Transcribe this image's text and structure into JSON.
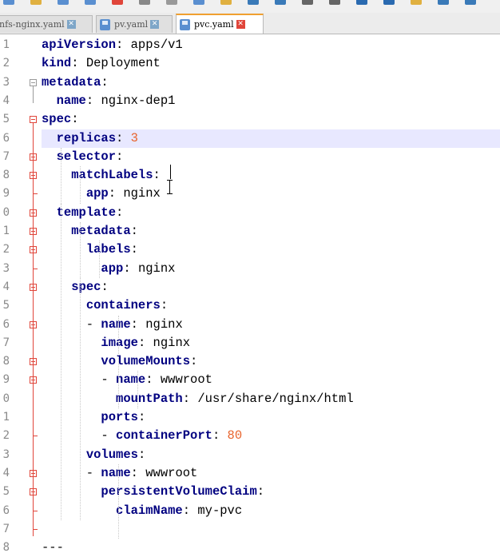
{
  "toolbar": {
    "icons": [
      "new-file-icon",
      "open-file-icon",
      "save-icon",
      "save-all-icon",
      "close-icon",
      "print-icon",
      "cut-icon",
      "copy-icon",
      "paste-icon",
      "undo-icon",
      "redo-icon",
      "find-icon",
      "replace-icon",
      "zoom-in-icon",
      "zoom-out-icon",
      "sync-icon",
      "wrap-icon",
      "indent-guide-icon"
    ]
  },
  "tabs": [
    {
      "label": "nfs-nginx.yaml",
      "active": false
    },
    {
      "label": "pv.yaml",
      "active": false
    },
    {
      "label": "pvc.yaml",
      "active": true
    }
  ],
  "editor": {
    "current_line": 6,
    "lines": [
      {
        "num": "1",
        "indent": "",
        "key": "apiVersion",
        "sep": ": ",
        "value": "apps/v1",
        "vtype": "str"
      },
      {
        "num": "2",
        "indent": "",
        "key": "kind",
        "sep": ": ",
        "value": "Deployment",
        "vtype": "str"
      },
      {
        "num": "3",
        "indent": "",
        "key": "metadata",
        "sep": ":",
        "value": "",
        "vtype": "str"
      },
      {
        "num": "4",
        "indent": "  ",
        "key": "name",
        "sep": ": ",
        "value": "nginx-dep1",
        "vtype": "str"
      },
      {
        "num": "5",
        "indent": "",
        "key": "spec",
        "sep": ":",
        "value": "",
        "vtype": "str"
      },
      {
        "num": "6",
        "indent": "  ",
        "key": "replicas",
        "sep": ": ",
        "value": "3",
        "vtype": "num"
      },
      {
        "num": "7",
        "indent": "  ",
        "key": "selector",
        "sep": ":",
        "value": "",
        "vtype": "str"
      },
      {
        "num": "8",
        "indent": "    ",
        "key": "matchLabels",
        "sep": ":",
        "value": "",
        "vtype": "str"
      },
      {
        "num": "9",
        "indent": "      ",
        "key": "app",
        "sep": ": ",
        "value": "nginx",
        "vtype": "str"
      },
      {
        "num": "0",
        "indent": "  ",
        "key": "template",
        "sep": ":",
        "value": "",
        "vtype": "str"
      },
      {
        "num": "1",
        "indent": "    ",
        "key": "metadata",
        "sep": ":",
        "value": "",
        "vtype": "str"
      },
      {
        "num": "2",
        "indent": "      ",
        "key": "labels",
        "sep": ":",
        "value": "",
        "vtype": "str"
      },
      {
        "num": "3",
        "indent": "        ",
        "key": "app",
        "sep": ": ",
        "value": "nginx",
        "vtype": "str"
      },
      {
        "num": "4",
        "indent": "    ",
        "key": "spec",
        "sep": ":",
        "value": "",
        "vtype": "str"
      },
      {
        "num": "5",
        "indent": "      ",
        "key": "containers",
        "sep": ":",
        "value": "",
        "vtype": "str"
      },
      {
        "num": "6",
        "indent": "      - ",
        "key": "name",
        "sep": ": ",
        "value": "nginx",
        "vtype": "str"
      },
      {
        "num": "7",
        "indent": "        ",
        "key": "image",
        "sep": ": ",
        "value": "nginx",
        "vtype": "str"
      },
      {
        "num": "8",
        "indent": "        ",
        "key": "volumeMounts",
        "sep": ":",
        "value": "",
        "vtype": "str"
      },
      {
        "num": "9",
        "indent": "        - ",
        "key": "name",
        "sep": ": ",
        "value": "wwwroot",
        "vtype": "str"
      },
      {
        "num": "0",
        "indent": "          ",
        "key": "mountPath",
        "sep": ": ",
        "value": "/usr/share/nginx/html",
        "vtype": "str"
      },
      {
        "num": "1",
        "indent": "        ",
        "key": "ports",
        "sep": ":",
        "value": "",
        "vtype": "str"
      },
      {
        "num": "2",
        "indent": "        - ",
        "key": "containerPort",
        "sep": ": ",
        "value": "80",
        "vtype": "num"
      },
      {
        "num": "3",
        "indent": "      ",
        "key": "volumes",
        "sep": ":",
        "value": "",
        "vtype": "str"
      },
      {
        "num": "4",
        "indent": "      - ",
        "key": "name",
        "sep": ": ",
        "value": "wwwroot",
        "vtype": "str"
      },
      {
        "num": "5",
        "indent": "        ",
        "key": "persistentVolumeClaim",
        "sep": ":",
        "value": "",
        "vtype": "str"
      },
      {
        "num": "6",
        "indent": "          ",
        "key": "claimName",
        "sep": ": ",
        "value": "my-pvc",
        "vtype": "str"
      },
      {
        "num": "7",
        "indent": "",
        "key": "",
        "sep": "",
        "value": "",
        "vtype": "str"
      },
      {
        "num": "8",
        "indent": "",
        "key": "",
        "sep": "",
        "value": "---",
        "vtype": "str"
      }
    ]
  },
  "colors": {
    "keyword": "#000080",
    "number": "#e8622a",
    "fold": "#e0453a",
    "current_line": "#e8e8ff"
  }
}
